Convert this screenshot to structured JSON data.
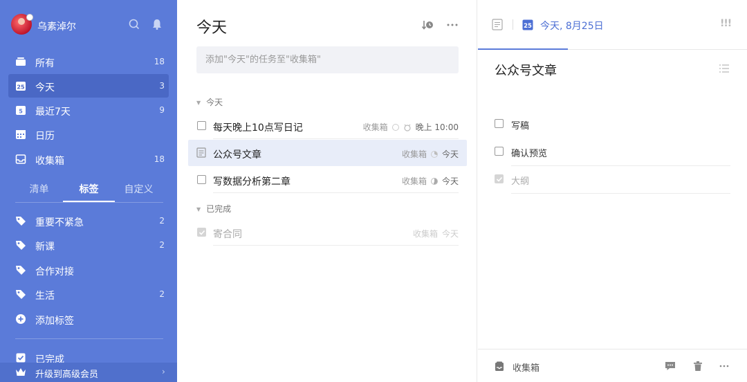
{
  "colors": {
    "sidebar": "#5b7bd9",
    "sidebar_active": "#4a68c5",
    "accent": "#4c6fd4"
  },
  "sidebar": {
    "username": "乌素淖尔",
    "header_icons": [
      "search-icon",
      "bell-icon"
    ],
    "smart_lists": [
      {
        "label": "所有",
        "count": "18",
        "icon": "all-tasks-icon"
      },
      {
        "label": "今天",
        "count": "3",
        "icon": "calendar-25-icon"
      },
      {
        "label": "最近7天",
        "count": "9",
        "icon": "week-icon"
      },
      {
        "label": "日历",
        "count": "",
        "icon": "calendar-icon"
      },
      {
        "label": "收集箱",
        "count": "18",
        "icon": "inbox-icon"
      }
    ],
    "segments": [
      "清单",
      "标签",
      "自定义"
    ],
    "tags": [
      {
        "label": "重要不紧急",
        "count": "2"
      },
      {
        "label": "新课",
        "count": "2"
      },
      {
        "label": "合作对接",
        "count": ""
      },
      {
        "label": "生活",
        "count": "2"
      }
    ],
    "add_tag": "添加标签",
    "completed": "已完成",
    "upgrade": "升级到高级会员"
  },
  "main": {
    "title": "今天",
    "add_placeholder": "添加\"今天\"的任务至\"收集箱\"",
    "section_today": "今天",
    "section_done": "已完成",
    "tasks": [
      {
        "title": "每天晚上10点写日记",
        "list": "收集箱",
        "due": "晚上 10:00"
      },
      {
        "title": "公众号文章",
        "list": "收集箱",
        "due": "今天"
      },
      {
        "title": "写数据分析第二章",
        "list": "收集箱",
        "due": "今天"
      }
    ],
    "done_tasks": [
      {
        "title": "寄合同",
        "list": "收集箱",
        "due": "今天"
      }
    ]
  },
  "detail": {
    "due": "今天, 8月25日",
    "priority": "!!!",
    "title": "公众号文章",
    "subtasks": [
      {
        "label": "写稿",
        "done": false
      },
      {
        "label": "确认预览",
        "done": false
      },
      {
        "label": "大纲",
        "done": true
      }
    ],
    "list_name": "收集箱"
  }
}
